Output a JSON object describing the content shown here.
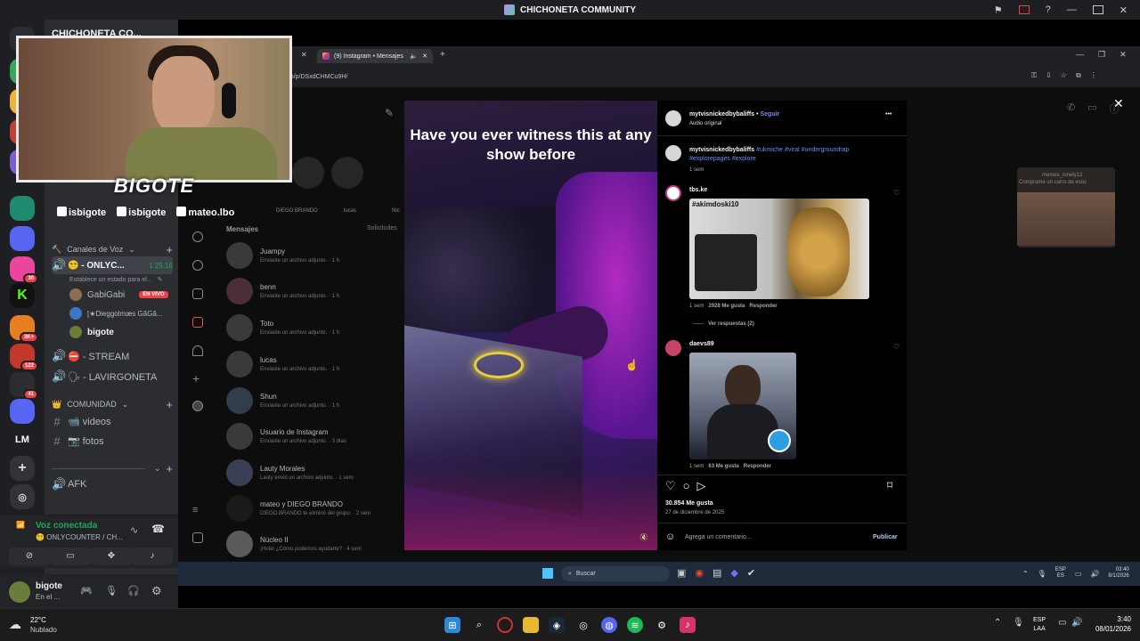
{
  "window": {
    "title": "CHICHONETA COMMUNITY"
  },
  "sidebar": {
    "server_name": "CHICHONETA CO...",
    "voice_category": "Canales de Voz",
    "onlycounter_channel": "😵‍💫 - ONLYC...",
    "onlycounter_timer": "1:25:16",
    "status_prompt": "Establece un estado para el...",
    "users": [
      {
        "name": "GabiGabi",
        "badge": "EN VIVO"
      },
      {
        "name": "[★Dieggolmæs GãGã..."
      },
      {
        "name": "bigote"
      }
    ],
    "stream_channel": "⛔ - STREAM",
    "lavirgoneta_channel": "🗣 - LAVIRGONETA",
    "community_category": "COMUNIDAD",
    "text_channels": [
      "📹 videos",
      "📷 fotos"
    ],
    "afk_channel": "AFK"
  },
  "voice_panel": {
    "status": "Voz conectada",
    "channel": "😵‍💫 ONLYCOUNTER / CH..."
  },
  "user_panel": {
    "name": "bigote",
    "status": "En el ..."
  },
  "weather": {
    "temp": "22°C",
    "desc": "Nublado"
  },
  "clock": {
    "time": "3:40",
    "date": "08/01/2026",
    "lang_top": "ESP",
    "lang_bottom": "LAA"
  },
  "servers": {
    "lm_label": "LM",
    "badges": [
      "30",
      "3K+",
      "122",
      "41"
    ]
  },
  "webcam": {
    "name": "BIGOTE",
    "socials": [
      "isbigote",
      "isbigote",
      "mateo.lbo"
    ]
  },
  "stream": {
    "browser_tab": "(9) Instagram • Mensajes",
    "url": "om/p/DSxdCHMCu9H/",
    "dm_header": "Mensajes",
    "dm_requests": "Solicitudes",
    "stories": [
      "DIEGO BRANDO",
      "lucas",
      "Nic"
    ],
    "dms": [
      {
        "name": "Juampy",
        "msg": "Enviaste un archivo adjunto. · 1 h"
      },
      {
        "name": "benn",
        "msg": "Enviaste un archivo adjunto. · 1 h"
      },
      {
        "name": "Toto",
        "msg": "Enviaste un archivo adjunto. · 1 h"
      },
      {
        "name": "lucas",
        "msg": "Enviaste un archivo adjunto. · 1 h"
      },
      {
        "name": "Shun",
        "msg": "Enviaste un archivo adjunto. · 1 h"
      },
      {
        "name": "Usuario de Instagram",
        "msg": "Enviaste un archivo adjunto. · 3 días"
      },
      {
        "name": "Lauty Morales",
        "msg": "Lauty envió un archivo adjunto. · 1 sem"
      },
      {
        "name": "mateo y DIEGO BRANDO",
        "msg": "DIEGO BRANDO te eliminó del grupo. · 2 sem"
      },
      {
        "name": "Núcleo II",
        "msg": "¡Hola! ¿Cómo podemos ayudarte? · 4 sem"
      }
    ],
    "video_caption": "Have you ever witness this at any show before",
    "post": {
      "author": "mytvisnickedbybaliffs",
      "follow": "Seguir",
      "audio": "Audio original",
      "caption_user": "mytvisnickedbybaliffs",
      "caption_tags": "#ukmiche #viral #undergroundrap #explorepages #explore",
      "caption_time": "1 sem",
      "comments": [
        {
          "user": "tbs.ke",
          "meme_text": "#akimdoski10",
          "time": "1 sem",
          "likes": "2928 Me gusta",
          "reply": "Responder",
          "replies": "Ver respuestas (2)"
        },
        {
          "user": "daevs89",
          "time": "1 sem",
          "likes": "63 Me gusta",
          "reply": "Responder"
        }
      ],
      "likes": "30.854 Me gusta",
      "date": "27 de diciembre de 2025",
      "comment_placeholder": "Agrega un comentario...",
      "publish": "Publicar"
    },
    "ghost_notice": "memes_lonely12",
    "ghost_sub": "Comprame un carro de esos",
    "taskbar_search": "Buscar",
    "clock_time": "03:40",
    "clock_date": "8/1/2026",
    "lang_top": "ESP",
    "lang_bottom": "ES"
  }
}
